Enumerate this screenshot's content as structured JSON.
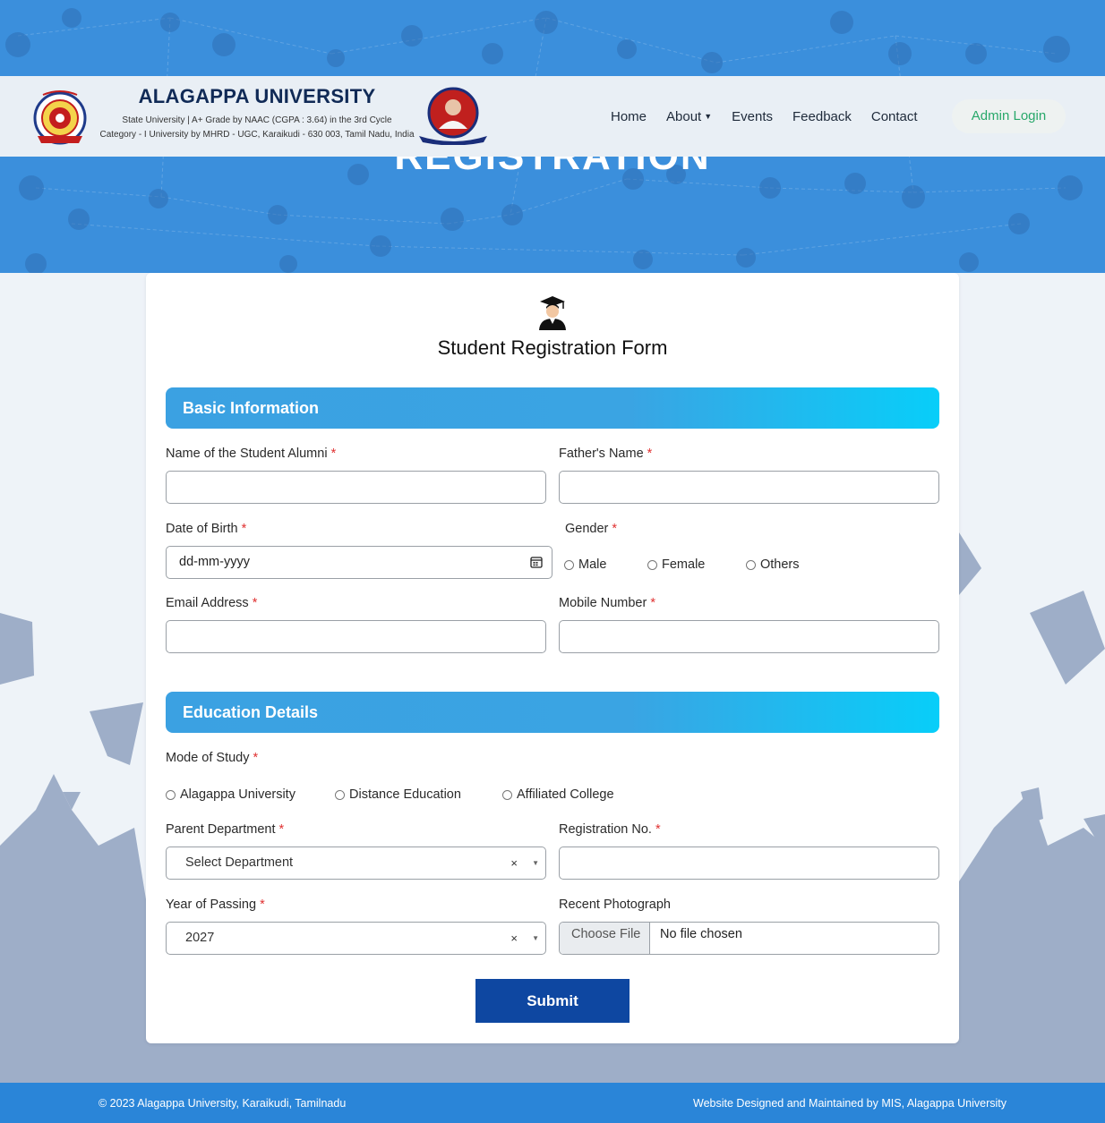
{
  "hero": {
    "title": "REGISTRATION"
  },
  "header": {
    "university_name": "ALAGAPPA UNIVERSITY",
    "subtitle_line1": "State University | A+ Grade by NAAC (CGPA : 3.64) in the 3rd Cycle",
    "subtitle_line2": "Category - I University by MHRD - UGC, Karaikudi - 630 003, Tamil Nadu, India",
    "nav": [
      "Home",
      "About",
      "Events",
      "Feedback",
      "Contact"
    ],
    "admin_login": "Admin Login"
  },
  "form": {
    "title": "Student Registration Form",
    "basic_section": "Basic Information",
    "fields": {
      "student_name": {
        "label": "Name of the Student Alumni",
        "value": ""
      },
      "father_name": {
        "label": "Father's Name",
        "value": ""
      },
      "dob": {
        "label": "Date of Birth",
        "placeholder": "dd-mm-yyyy"
      },
      "gender": {
        "label": "Gender",
        "options": [
          "Male",
          "Female",
          "Others"
        ]
      },
      "email": {
        "label": "Email Address",
        "value": ""
      },
      "mobile": {
        "label": "Mobile Number",
        "value": ""
      }
    },
    "education_section": "Education Details",
    "edu": {
      "mode": {
        "label": "Mode of Study",
        "options": [
          "Alagappa University",
          "Distance Education",
          "Affiliated College"
        ]
      },
      "department": {
        "label": "Parent Department",
        "value": "Select Department"
      },
      "regno": {
        "label": "Registration No.",
        "value": ""
      },
      "year": {
        "label": "Year of Passing",
        "value": "2027"
      },
      "photo": {
        "label": "Recent Photograph",
        "button": "Choose File",
        "status": "No file chosen"
      }
    },
    "required_mark": "*",
    "clear_symbol": "×",
    "submit": "Submit"
  },
  "footer": {
    "left": "© 2023 Alagappa University, Karaikudi, Tamilnadu",
    "right": "Website Designed and Maintained by MIS, Alagappa University"
  },
  "colors": {
    "hero_bg": "#3b8fdc",
    "section_gradient_start": "#3ba1e2",
    "section_gradient_end": "#08cef9",
    "submit_bg": "#0e47a1",
    "admin_text": "#28a86a",
    "footer_bg": "#2a85d8",
    "required": "#e03131"
  }
}
